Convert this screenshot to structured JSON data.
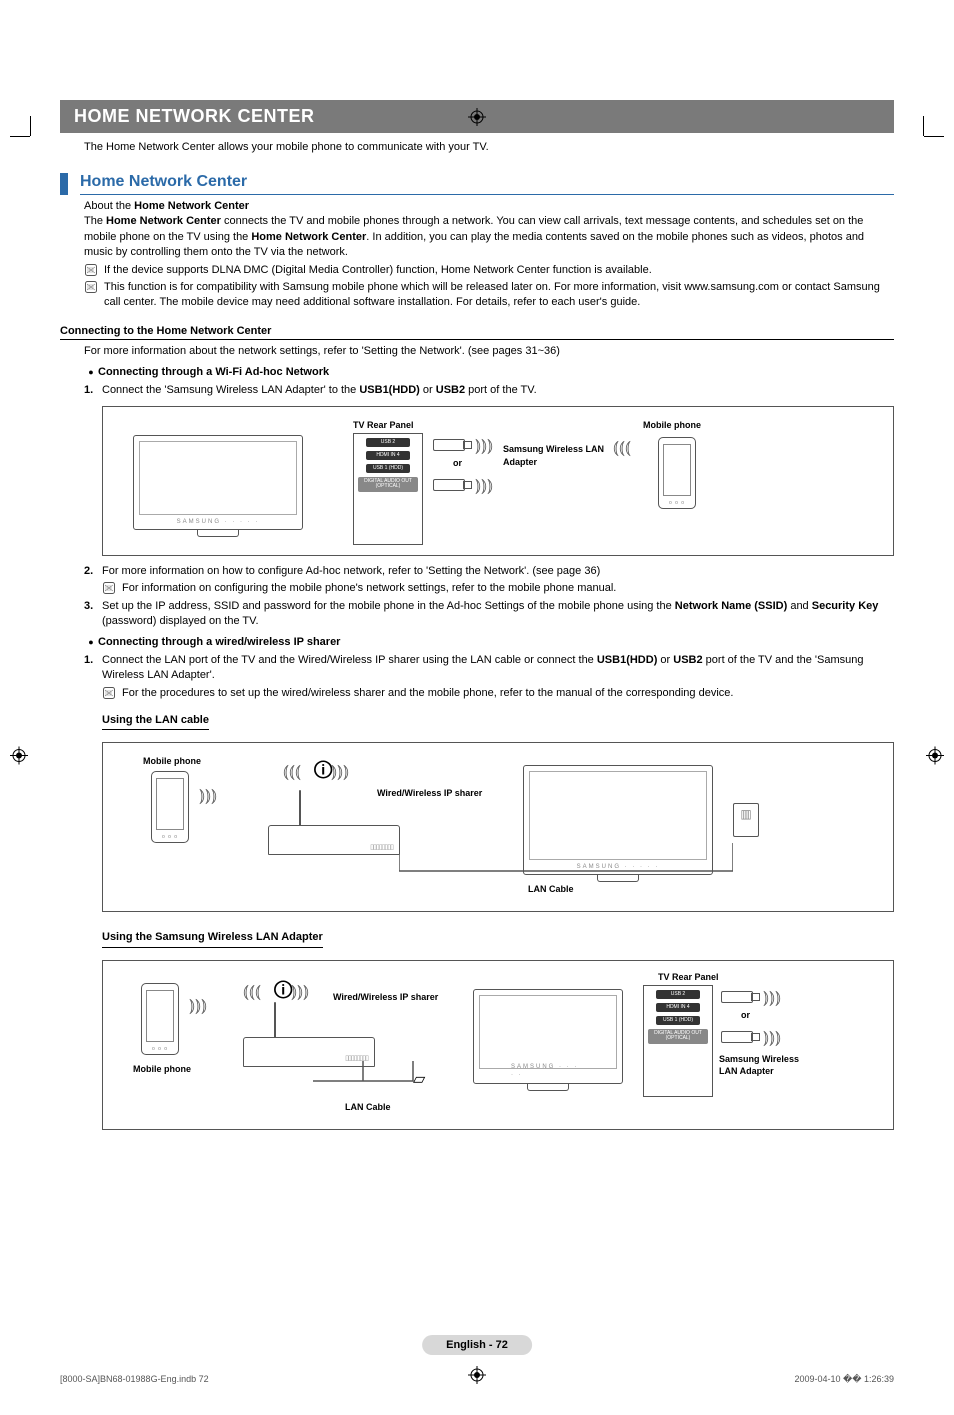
{
  "titleBar": "HOME NETWORK CENTER",
  "intro": "The Home Network Center allows your mobile phone to communicate with your TV.",
  "sectionHeading": "Home Network Center",
  "about": {
    "prefix": "About the ",
    "bold": "Home Network Center"
  },
  "para1": {
    "t1": "The ",
    "b1": "Home Network Center",
    "t2": " connects the TV and mobile phones through a network. You can view call arrivals, text message contents, and schedules set on the mobile phone on the TV using the ",
    "b2": "Home Network Center",
    "t3": ". In addition, you can play the media contents saved on the mobile phones such as videos, photos and music by controlling them onto the TV via the network."
  },
  "note1": "If the device supports DLNA DMC (Digital Media Controller) function, Home Network Center function is available.",
  "note2": "This function is for compatibility with Samsung mobile phone which will be released later on. For more information, visit www.samsung.com or contact Samsung call center. The mobile device may need additional software installation. For details, refer to each user's guide.",
  "connectingHeading": "Connecting to the Home Network Center",
  "connectingIntro": "For more information about the network settings, refer to 'Setting the Network'. (see pages 31~36)",
  "adhocBullet": "Connecting through a Wi-Fi Ad-hoc Network",
  "adhocStep1": {
    "t1": "Connect the 'Samsung Wireless LAN Adapter' to the ",
    "b1": "USB1(HDD)",
    "t2": " or ",
    "b2": "USB2",
    "t3": " port of the TV."
  },
  "diagram1": {
    "tvRear": "TV Rear Panel",
    "mobile": "Mobile phone",
    "or": "or",
    "adapter": "Samsung Wireless LAN Adapter",
    "usb2": "USB 2",
    "hdmi": "HDMI IN 4",
    "usb1": "USB 1 (HDD)",
    "ext": "DIGITAL AUDIO OUT (OPTICAL)"
  },
  "adhocStep2": "For more information on how to configure Ad-hoc network, refer to 'Setting the Network'. (see page 36)",
  "adhocStep2note": "For information on configuring the mobile phone's network settings, refer to the mobile phone manual.",
  "adhocStep3": {
    "t1": "Set up the IP address, SSID and password for the mobile phone in the Ad-hoc Settings of the mobile phone using the ",
    "b1": "Network Name (SSID)",
    "t2": " and ",
    "b2": "Security Key",
    "t3": " (password) displayed on the TV."
  },
  "sharerBullet": "Connecting through a wired/wireless IP sharer",
  "sharerStep1": {
    "t1": "Connect the LAN port of the TV and the Wired/Wireless IP sharer using the LAN cable or connect the ",
    "b1": "USB1(HDD)",
    "t2": " or ",
    "b2": "USB2",
    "t3": " port of the TV and the 'Samsung Wireless LAN Adapter'."
  },
  "sharerStep1note": "For the procedures to set up the wired/wireless sharer and the mobile phone, refer to the manual of the corresponding device.",
  "diagram2Heading": "Using the LAN cable",
  "diagram2": {
    "mobile": "Mobile phone",
    "sharer": "Wired/Wireless IP sharer",
    "lancable": "LAN Cable"
  },
  "diagram3Heading": "Using the Samsung Wireless LAN Adapter",
  "diagram3": {
    "mobile": "Mobile phone",
    "sharer": "Wired/Wireless IP sharer",
    "lancable": "LAN Cable",
    "tvRear": "TV Rear Panel",
    "or": "or",
    "adapter": "Samsung Wireless LAN Adapter",
    "usb2": "USB 2",
    "hdmi": "HDMI IN 4",
    "usb1": "USB 1 (HDD)",
    "ext": "DIGITAL AUDIO OUT (OPTICAL)"
  },
  "footerPage": "English - 72",
  "footerLeft": "[8000-SA]BN68-01988G-Eng.indb   72",
  "footerRight": "2009-04-10   �� 1:26:39"
}
